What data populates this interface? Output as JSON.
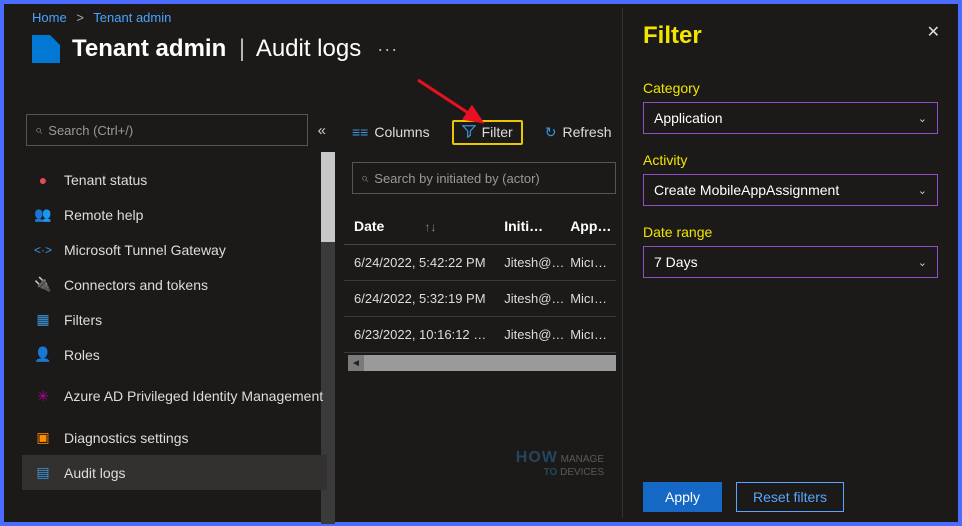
{
  "breadcrumb": {
    "home": "Home",
    "tenant": "Tenant admin"
  },
  "title": {
    "main": "Tenant admin",
    "sub": "Audit logs"
  },
  "sidebar": {
    "search_placeholder": "Search (Ctrl+/)",
    "items": [
      {
        "label": "Tenant status",
        "glyph": "👤",
        "color": "#e74856"
      },
      {
        "label": "Remote help",
        "glyph": "👥",
        "color": "#3a96dd"
      },
      {
        "label": "Microsoft Tunnel Gateway",
        "glyph": "<·>",
        "color": "#3a96dd"
      },
      {
        "label": "Connectors and tokens",
        "glyph": "🔌",
        "color": "#3a96dd"
      },
      {
        "label": "Filters",
        "glyph": "▦",
        "color": "#3a96dd"
      },
      {
        "label": "Roles",
        "glyph": "👤",
        "color": "#6bb700"
      },
      {
        "label": "Azure AD Privileged Identity Management",
        "glyph": "✳",
        "color": "#b4009e"
      },
      {
        "label": "Diagnostics settings",
        "glyph": "▣",
        "color": "#ff8c00"
      },
      {
        "label": "Audit logs",
        "glyph": "▤",
        "color": "#3a96dd"
      }
    ]
  },
  "toolbar": {
    "columns": "Columns",
    "filter": "Filter",
    "refresh": "Refresh"
  },
  "table": {
    "search_placeholder": "Search by initiated by (actor)",
    "headers": {
      "date": "Date",
      "init": "Initi…",
      "app": "App…"
    },
    "rows": [
      {
        "date": "6/24/2022, 5:42:22 PM",
        "init": "Jitesh@…",
        "app": "Micı…"
      },
      {
        "date": "6/24/2022, 5:32:19 PM",
        "init": "Jitesh@…",
        "app": "Micı…"
      },
      {
        "date": "6/23/2022, 10:16:12 …",
        "init": "Jitesh@…",
        "app": "Micı…"
      }
    ]
  },
  "filter_panel": {
    "title": "Filter",
    "fields": {
      "category": {
        "label": "Category",
        "value": "Application"
      },
      "activity": {
        "label": "Activity",
        "value": "Create MobileAppAssignment"
      },
      "date": {
        "label": "Date range",
        "value": "7 Days"
      }
    },
    "apply": "Apply",
    "reset": "Reset filters"
  }
}
